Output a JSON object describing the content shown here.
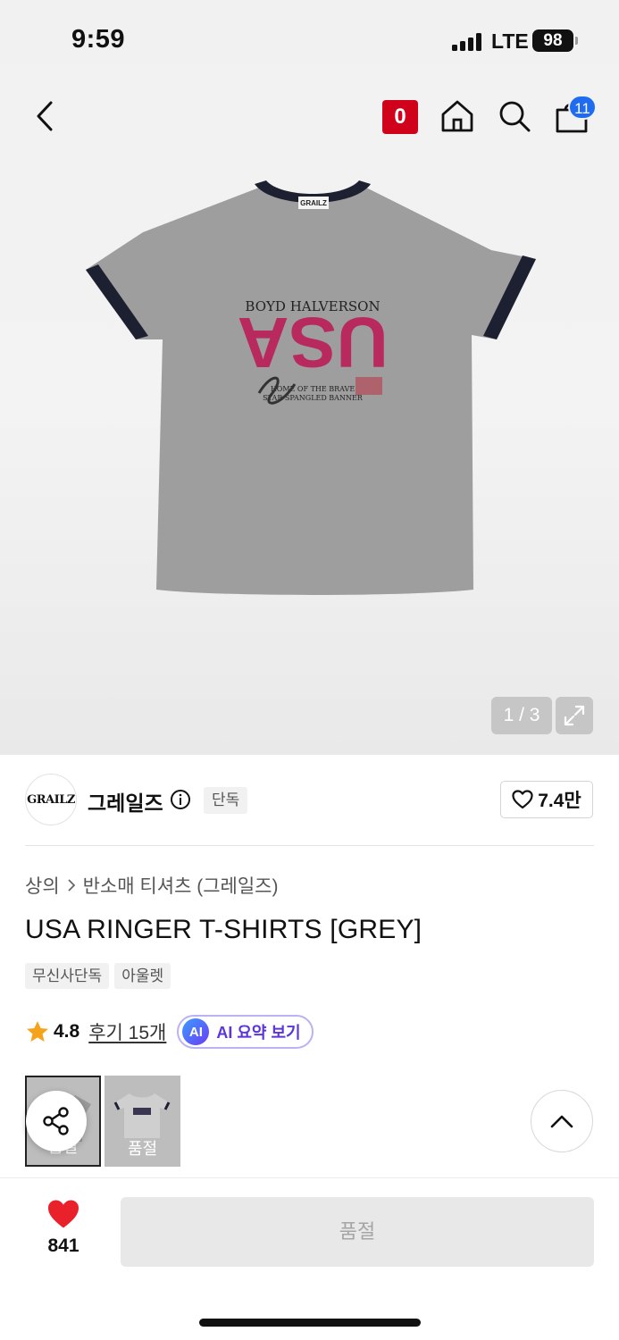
{
  "status_bar": {
    "time": "9:59",
    "network": "LTE",
    "battery": "98"
  },
  "header": {
    "zero_badge": "0",
    "cart_count": "11",
    "icons": [
      "back-arrow-icon",
      "home-icon",
      "search-icon",
      "shopping-bag-icon"
    ]
  },
  "product_image": {
    "counter": "1 / 3",
    "print_lines": [
      "BOYD HALVERSON",
      "USA",
      "HOME OF THE BRAVE",
      "STAR SPANGLED BANNER"
    ],
    "label_tag": "GRAILZ"
  },
  "brand": {
    "logo_text": "GRAILZ",
    "name": "그레일즈",
    "exclusive_tag": "단독",
    "likes": "7.4만"
  },
  "breadcrumb": {
    "category": "상의",
    "subcategory": "반소매 티셔츠 (그레일즈)"
  },
  "title": "USA RINGER T-SHIRTS [GREY]",
  "tags": [
    "무신사단독",
    "아울렛"
  ],
  "rating": {
    "value": "4.8",
    "reviews_label": "후기 15개",
    "ai_badge": "AI",
    "ai_label": "AI 요약 보기"
  },
  "options": [
    {
      "label": "품절"
    },
    {
      "label": "품절"
    }
  ],
  "bottom": {
    "wish_count": "841",
    "soldout_label": "품절"
  },
  "colors": {
    "accent_red": "#d0021b",
    "cart_badge": "#1f6cf0",
    "ai_purple": "#5b35d9",
    "star": "#f5a31a",
    "heart": "#e8212b"
  }
}
